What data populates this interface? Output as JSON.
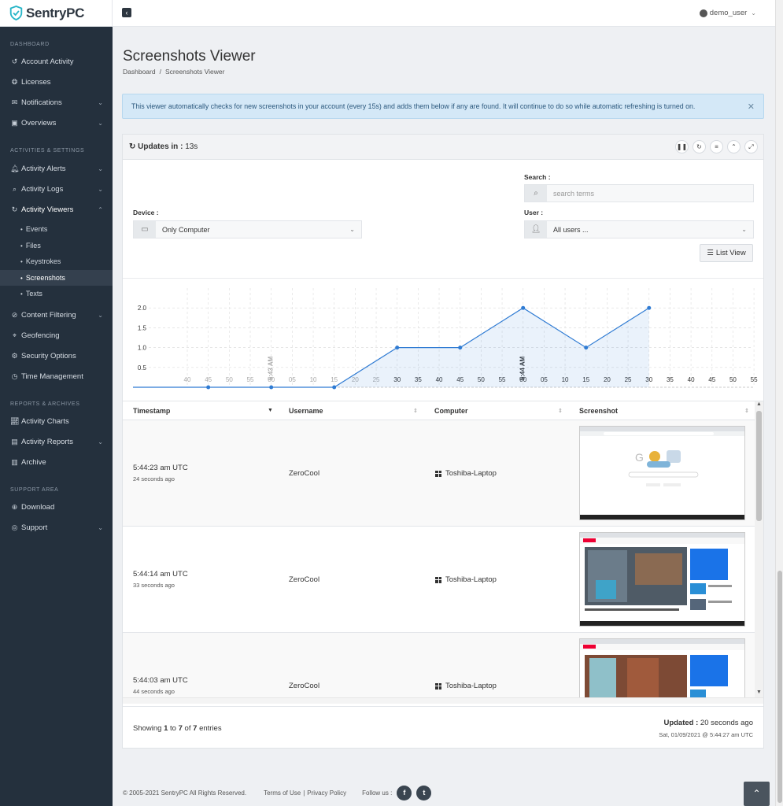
{
  "brand": {
    "name": "SentryPC"
  },
  "user": {
    "name": "demo_user"
  },
  "sidebar": {
    "sections": [
      {
        "label": "DASHBOARD"
      },
      {
        "label": "ACTIVITIES & SETTINGS"
      },
      {
        "label": "REPORTS & ARCHIVES"
      },
      {
        "label": "SUPPORT AREA"
      }
    ],
    "items": [
      {
        "label": "Account Activity"
      },
      {
        "label": "Licenses"
      },
      {
        "label": "Notifications"
      },
      {
        "label": "Overviews"
      },
      {
        "label": "Activity Alerts"
      },
      {
        "label": "Activity Logs"
      },
      {
        "label": "Activity Viewers"
      },
      {
        "label": "Content Filtering"
      },
      {
        "label": "Geofencing"
      },
      {
        "label": "Security Options"
      },
      {
        "label": "Time Management"
      },
      {
        "label": "Activity Charts"
      },
      {
        "label": "Activity Reports"
      },
      {
        "label": "Archive"
      },
      {
        "label": "Download"
      },
      {
        "label": "Support"
      }
    ],
    "subitems": [
      {
        "label": "Events"
      },
      {
        "label": "Files"
      },
      {
        "label": "Keystrokes"
      },
      {
        "label": "Screenshots"
      },
      {
        "label": "Texts"
      }
    ]
  },
  "page": {
    "title": "Screenshots Viewer",
    "breadcrumb": [
      "Dashboard",
      "Screenshots Viewer"
    ]
  },
  "alert": {
    "text": "This viewer automatically checks for new screenshots in your account (every 15s) and adds them below if any are found.  It will continue to do so while automatic refreshing is turned on."
  },
  "panel": {
    "updates_label": "Updates in :",
    "updates_value": "13s"
  },
  "filters": {
    "search_label": "Search :",
    "search_placeholder": "search terms",
    "device_label": "Device :",
    "device_value": "Only Computer",
    "user_label": "User :",
    "user_value": "All users ...",
    "list_view_label": "List View"
  },
  "chart_data": {
    "type": "area",
    "y_ticks": [
      "0.5",
      "1.0",
      "1.5",
      "2.0"
    ],
    "ylim": [
      0,
      2.5
    ],
    "x_tick_labels": [
      "40",
      "45",
      "50",
      "55",
      "00",
      "05",
      "10",
      "15",
      "20",
      "25",
      "30",
      "35",
      "40",
      "45",
      "50",
      "55",
      "00",
      "05",
      "10",
      "15",
      "20",
      "25",
      "30",
      "35",
      "40",
      "45",
      "50",
      "55"
    ],
    "markers": [
      "5:43 AM",
      "5:44 AM"
    ],
    "points": [
      {
        "x": "5:42:45",
        "y": 0
      },
      {
        "x": "5:43:00",
        "y": 0
      },
      {
        "x": "5:43:15",
        "y": 0
      },
      {
        "x": "5:43:30",
        "y": 1
      },
      {
        "x": "5:43:45",
        "y": 1
      },
      {
        "x": "5:44:00",
        "y": 2
      },
      {
        "x": "5:44:15",
        "y": 1
      },
      {
        "x": "5:44:30",
        "y": 2
      }
    ],
    "color": "#2f7bd3",
    "grid": true
  },
  "table": {
    "columns": [
      {
        "label": "Timestamp"
      },
      {
        "label": "Username"
      },
      {
        "label": "Computer"
      },
      {
        "label": "Screenshot"
      }
    ],
    "rows": [
      {
        "time": "5:44:23 am UTC",
        "ago": "24 seconds ago",
        "user": "ZeroCool",
        "computer": "Toshiba-Laptop"
      },
      {
        "time": "5:44:14 am UTC",
        "ago": "33 seconds ago",
        "user": "ZeroCool",
        "computer": "Toshiba-Laptop"
      },
      {
        "time": "5:44:03 am UTC",
        "ago": "44 seconds ago",
        "user": "ZeroCool",
        "computer": "Toshiba-Laptop"
      }
    ]
  },
  "footer": {
    "showing_prefix": "Showing",
    "showing_from": "1",
    "showing_to_word": "to",
    "showing_to": "7",
    "showing_of_word": "of",
    "showing_total": "7",
    "showing_suffix": "entries",
    "updated_label": "Updated :",
    "updated_value": "20 seconds ago",
    "updated_timestamp": "Sat, 01/09/2021 @ 5:44:27 am UTC",
    "copyright": "© 2005-2021 SentryPC All Rights Reserved.",
    "terms": "Terms of Use",
    "privacy": "Privacy Policy",
    "follow": "Follow us :"
  }
}
